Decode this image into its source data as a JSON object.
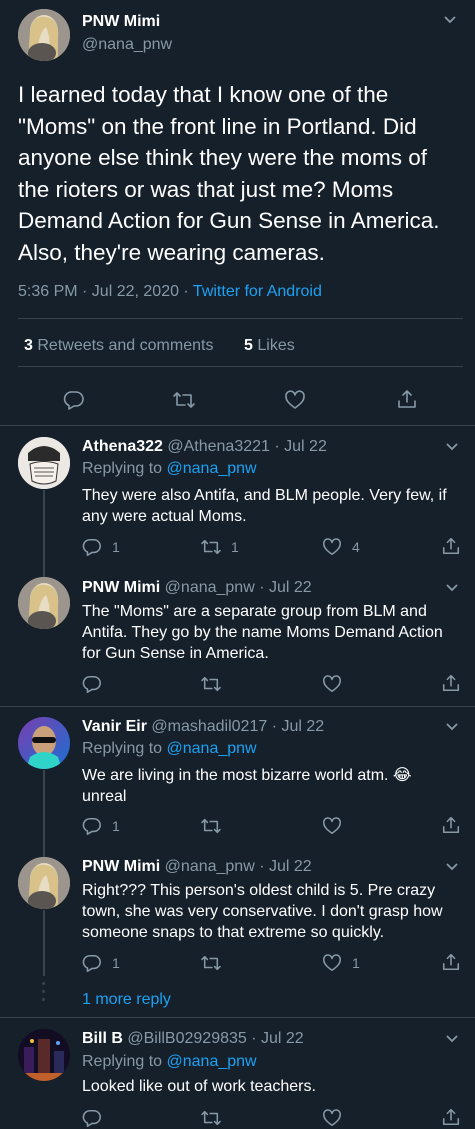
{
  "main_tweet": {
    "display_name": "PNW Mimi",
    "handle": "@nana_pnw",
    "text": "I learned today that I know one of the \"Moms\" on the front line in Portland. Did anyone else think they were the moms of the rioters or was that just me?   Moms Demand Action for Gun Sense in America. Also, they're wearing cameras.",
    "time": "5:36 PM · Jul 22, 2020 ·",
    "source": "Twitter for Android",
    "retweets_count": "3",
    "retweets_label": "Retweets and comments",
    "likes_count": "5",
    "likes_label": "Likes"
  },
  "replies": [
    {
      "display_name": "Athena322",
      "meta": "@Athena3221 · Jul 22",
      "replying_label": "Replying to",
      "replying_handle": "@nana_pnw",
      "text": "They were also Antifa, and BLM people. Very few, if any were actual Moms.",
      "replies": "1",
      "retweets": "1",
      "likes": "4"
    },
    {
      "display_name": "PNW Mimi",
      "meta": "@nana_pnw · Jul 22",
      "text": "The \"Moms\" are a separate group from BLM and Antifa.  They go by the name  Moms Demand Action for Gun Sense in America.",
      "replies": "",
      "retweets": "",
      "likes": ""
    },
    {
      "display_name": "Vanir Eir",
      "meta": "@mashadil0217 · Jul 22",
      "replying_label": "Replying to",
      "replying_handle": "@nana_pnw",
      "text": "We are living in the most bizarre world atm. 😂 unreal",
      "replies": "1",
      "retweets": "",
      "likes": ""
    },
    {
      "display_name": "PNW Mimi",
      "meta": "@nana_pnw · Jul 22",
      "text": "Right??? This person's oldest child is 5.  Pre crazy town, she was very conservative.  I don't grasp how someone snaps to that extreme so quickly.",
      "replies": "1",
      "retweets": "",
      "likes": "1"
    },
    {
      "display_name": "Bill B",
      "meta": "@BillB02929835 · Jul 22",
      "replying_label": "Replying to",
      "replying_handle": "@nana_pnw",
      "text": "Looked like out of work teachers."
    }
  ],
  "more_replies": "1 more reply",
  "colors": {
    "background": "#15202b",
    "accent": "#1da1f2",
    "muted": "#8899a6",
    "divider": "#38444d"
  },
  "icons": [
    "reply-icon",
    "retweet-icon",
    "like-icon",
    "share-icon",
    "chevron-down-icon"
  ]
}
